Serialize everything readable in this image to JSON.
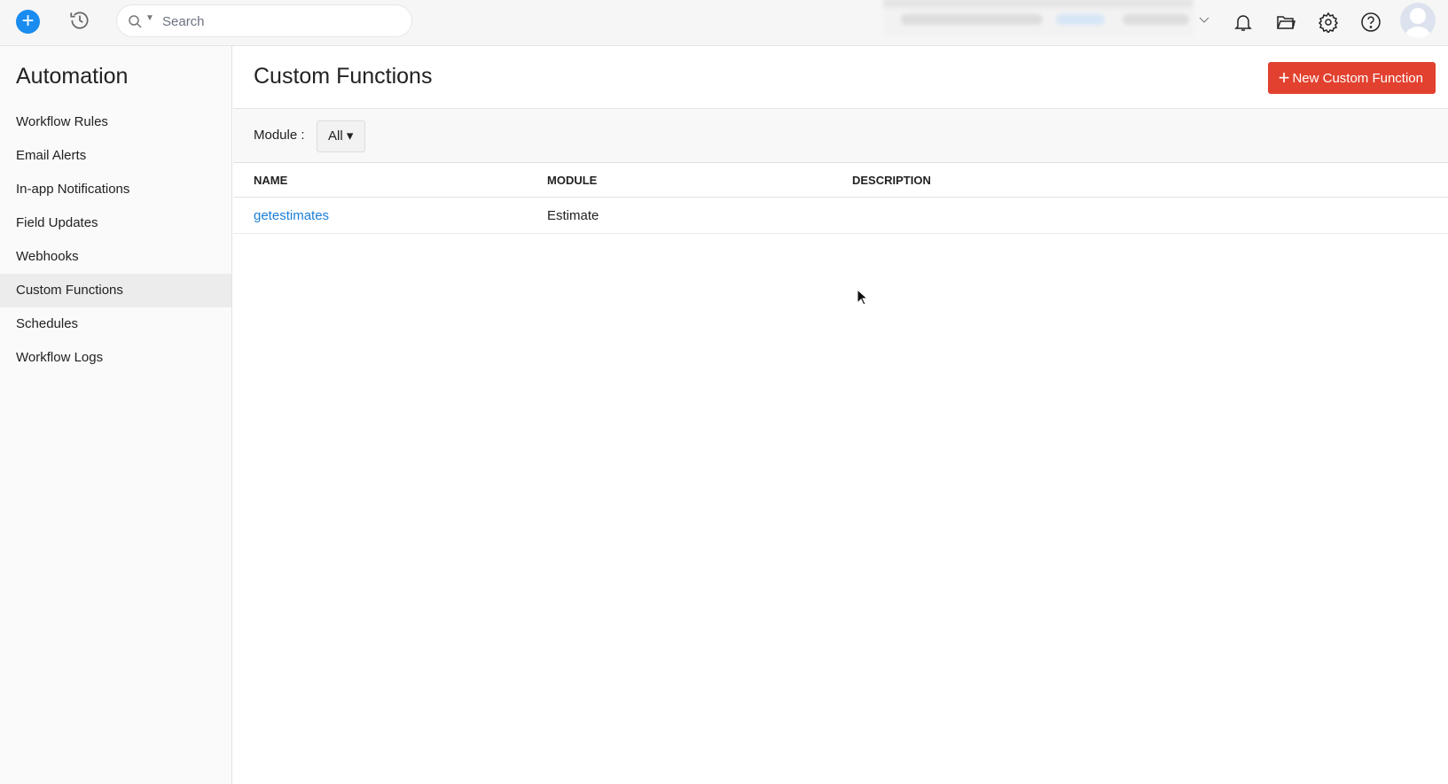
{
  "topbar": {
    "search_placeholder": "Search"
  },
  "sidebar": {
    "title": "Automation",
    "items": [
      {
        "label": "Workflow Rules"
      },
      {
        "label": "Email Alerts"
      },
      {
        "label": "In-app Notifications"
      },
      {
        "label": "Field Updates"
      },
      {
        "label": "Webhooks"
      },
      {
        "label": "Custom Functions",
        "active": true
      },
      {
        "label": "Schedules"
      },
      {
        "label": "Workflow Logs"
      }
    ]
  },
  "main": {
    "title": "Custom Functions",
    "new_button": "New Custom Function",
    "filter": {
      "label": "Module :",
      "value": "All ▾"
    },
    "columns": [
      "NAME",
      "MODULE",
      "DESCRIPTION"
    ],
    "rows": [
      {
        "name": "getestimates",
        "module": "Estimate",
        "description": ""
      }
    ]
  },
  "colors": {
    "accent": "#e2412f",
    "link": "#1a7fd8",
    "plus": "#1a8cf0"
  }
}
